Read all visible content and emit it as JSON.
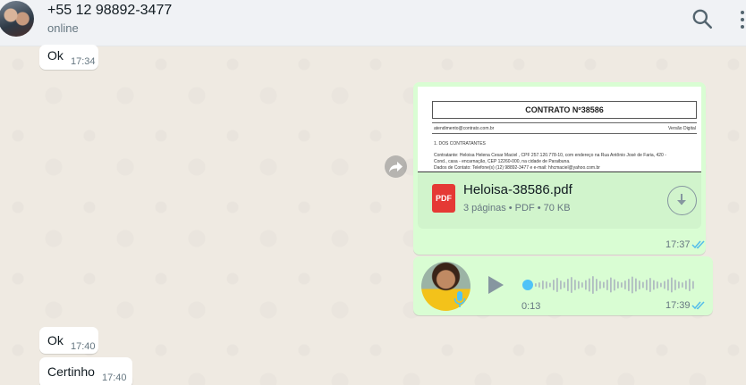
{
  "header": {
    "contact_name": "+55 12 98892-3477",
    "status": "online",
    "search_icon": "search-icon",
    "menu_icon": "more-vertical-icon"
  },
  "messages": {
    "ok_top": {
      "text": "Ok",
      "time": "17:34"
    },
    "document": {
      "preview": {
        "title": "CONTRATO Nº38586",
        "email": "atendimento@contrato.com.br",
        "version": "Versão Digital",
        "section": "1. DOS CONTRATANTES",
        "line1": "Contratante: Heloisa Helena Cesar Maciel , CPF 257.120.778-10, com endereço na Rua Antônio José de Faria, 420 -",
        "line2": "Cond., casa - encarnação, CEP 12260-000, na cidade de Paraibuna.",
        "line3": "Dados de Contato: Telefone(s) (12) 98892-3477 e e-mail: hhcmaciel@yahoo.com.br"
      },
      "file_badge": "PDF",
      "file_name": "Heloisa-38586.pdf",
      "file_meta": "3 páginas • PDF • 70 KB",
      "time": "17:37"
    },
    "audio": {
      "duration": "0:13",
      "time": "17:39",
      "progress": 0.0
    },
    "ok_bottom": {
      "text": "Ok",
      "time": "17:40"
    },
    "certinho": {
      "text": "Certinho",
      "time": "17:40"
    }
  },
  "colors": {
    "outgoing_bubble": "#d9fdd3",
    "incoming_bubble": "#ffffff",
    "read_ticks": "#53bdeb",
    "pdf_red": "#e53935"
  }
}
